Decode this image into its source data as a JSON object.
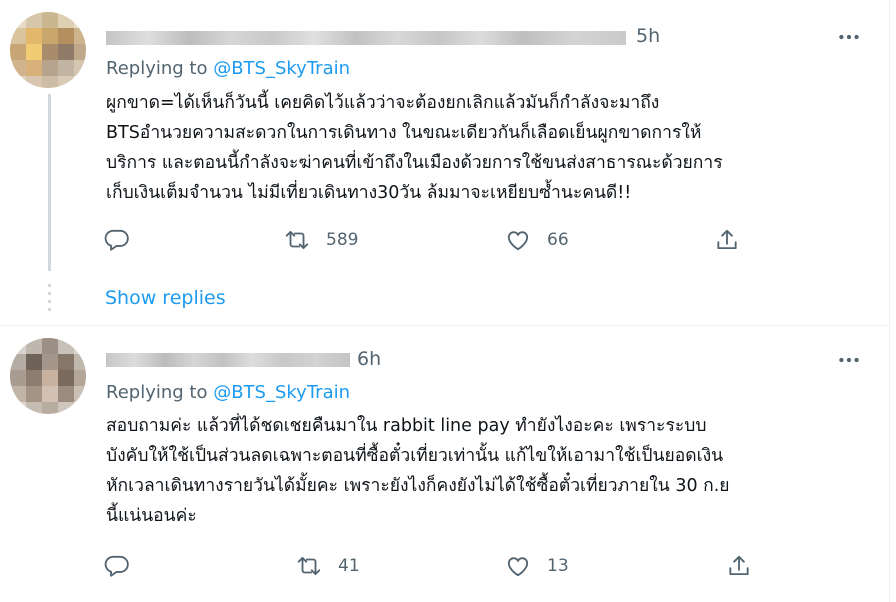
{
  "tweets": [
    {
      "time": "5h",
      "replying_prefix": "Replying to ",
      "replying_handle": "@BTS_SkyTrain",
      "lines": [
        "ผูกขาด=ได้เห็นก็วันนี้ เคยคิดไว้แล้วว่าจะต้องยกเลิกแล้วมันก็กำลังจะมาถึง",
        "BTSอำนวยความสะดวกในการเดินทาง ในขณะเดียวกันก็เลือดเย็นผูกขาดการให้",
        "บริการ และตอนนี้กำลังจะฆ่าคนที่เข้าถึงในเมืองด้วยการใช้ขนส่งสาธารณะด้วยการ",
        "เก็บเงินเต็มจำนวน ไม่มีเที่ยวเดินทาง30วัน ล้มมาจะเหยียบซ้ำนะคนดี!!"
      ],
      "retweets": "589",
      "likes": "66",
      "show_replies": "Show replies"
    },
    {
      "time": "6h",
      "replying_prefix": "Replying to ",
      "replying_handle": "@BTS_SkyTrain",
      "lines": [
        "สอบถามค่ะ แล้วที่ได้ชดเชยคืนมาใน rabbit line pay ทำยังไงอะคะ เพราะระบบ",
        "บังคับให้ใช้เป็นส่วนลดเฉพาะตอนที่ซื้อตั๋วเที่ยวเท่านั้น แก้ไขให้เอามาใช้เป็นยอดเงิน",
        "หักเวลาเดินทางรายวันได้มั้ยคะ เพราะยังไงก็คงยังไม่ได้ใช้ซื้อตั๋วเที่ยวภายใน 30 ก.ย",
        "นี้แน่นอนค่ะ"
      ],
      "retweets": "41",
      "likes": "13"
    }
  ],
  "icons": {
    "reply": "reply-icon",
    "retweet": "retweet-icon",
    "like": "heart-icon",
    "share": "share-icon",
    "more": "more-icon"
  },
  "colors": {
    "link": "#1d9bf0",
    "muted": "#536471",
    "text": "#0f1419",
    "thread_line": "#cfd9de"
  }
}
